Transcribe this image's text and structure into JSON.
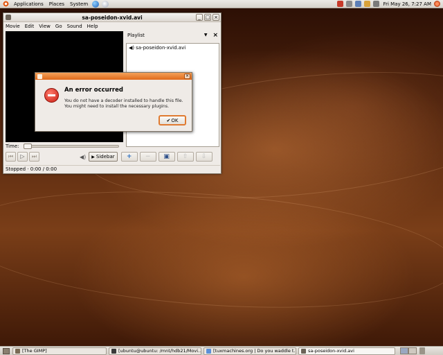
{
  "top_panel": {
    "menus": [
      "Applications",
      "Places",
      "System"
    ],
    "datetime": "Fri May 26,  7:27 AM"
  },
  "window": {
    "title": "sa-poseidon-xvid.avi",
    "menubar": [
      "Movie",
      "Edit",
      "View",
      "Go",
      "Sound",
      "Help"
    ],
    "playlist_label": "Playlist",
    "playlist_items": [
      "sa-poseidon-xvid.avi"
    ],
    "time_label": "Time:",
    "sidebar_label": "Sidebar",
    "status": "Stopped · 0:00 / 0:00"
  },
  "dialog": {
    "heading": "An error occurred",
    "line1": "You do not have a decoder installed to handle this file.",
    "line2": "You might need to install the necessary plugins.",
    "ok_label": "OK"
  },
  "taskbar": {
    "tasks": [
      "[The GIMP]",
      "[ubuntu@ubuntu: /mnt/hdb21/Movi...",
      "[tuxmachines.org | Do you waddle t...",
      "sa-poseidon-xvid.avi"
    ]
  },
  "colors": {
    "accent_orange": "#e06a1a",
    "panel_gray": "#d6d2cb"
  }
}
